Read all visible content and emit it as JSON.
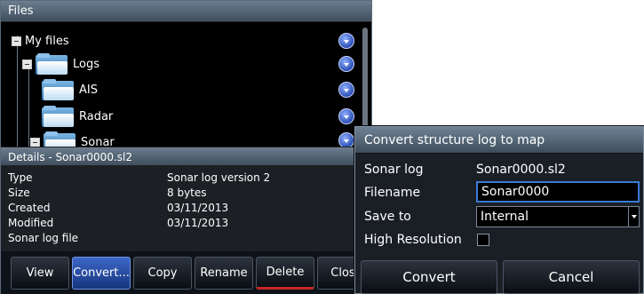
{
  "files_window": {
    "title": "Files",
    "tree": {
      "root": "My files",
      "items": [
        {
          "label": "Logs"
        },
        {
          "label": "AIS"
        },
        {
          "label": "Radar"
        },
        {
          "label": "Sonar"
        }
      ]
    },
    "details": {
      "title": "Details - Sonar0000.sl2",
      "rows": [
        {
          "label": "Type",
          "value": "Sonar log version 2"
        },
        {
          "label": "Size",
          "value": "8 bytes"
        },
        {
          "label": "Created",
          "value": "03/11/2013"
        },
        {
          "label": "Modified",
          "value": "03/11/2013"
        },
        {
          "label": "Sonar log file",
          "value": ""
        }
      ]
    },
    "buttons": {
      "view": "View",
      "convert": "Convert...",
      "copy": "Copy",
      "rename": "Rename",
      "delete": "Delete",
      "close": "Close"
    }
  },
  "dialog": {
    "title": "Convert structure log to map",
    "sonar_log_label": "Sonar log",
    "sonar_log_value": "Sonar0000.sl2",
    "filename_label": "Filename",
    "filename_value": "Sonar0000",
    "save_to_label": "Save to",
    "save_to_value": "Internal",
    "high_res_label": "High Resolution",
    "high_res_checked": false,
    "convert_button": "Convert",
    "cancel_button": "Cancel"
  }
}
